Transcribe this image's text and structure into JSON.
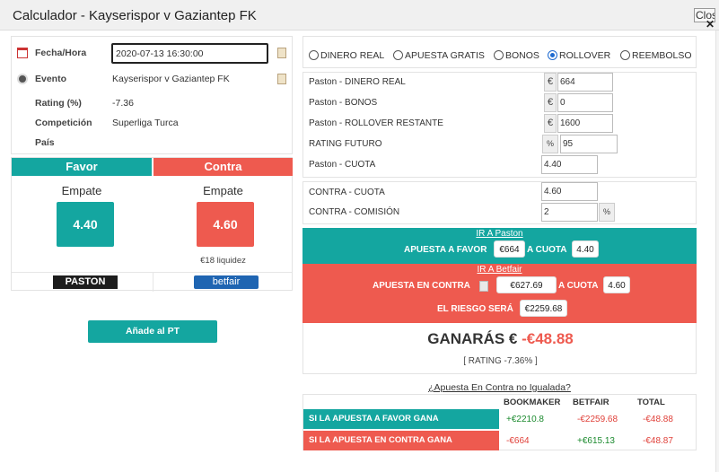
{
  "window": {
    "title": "Calculador - Kayserispor v Gaziantep FK",
    "close_label": "Close"
  },
  "info": {
    "fecha_label": "Fecha/Hora",
    "fecha_value": "2020-07-13 16:30:00",
    "evento_label": "Evento",
    "evento_value": "Kayserispor v Gaziantep FK",
    "rating_label": "Rating (%)",
    "rating_value": "-7.36",
    "competicion_label": "Competición",
    "competicion_value": "Superliga Turca",
    "pais_label": "País",
    "pais_value": ""
  },
  "odds": {
    "favor_label": "Favor",
    "contra_label": "Contra",
    "favor_selection": "Empate",
    "contra_selection": "Empate",
    "favor_odd": "4.40",
    "contra_odd": "4.60",
    "liquidez": "€18 liquidez",
    "paston_logo": "PASTON",
    "betfair_logo": "betfair"
  },
  "add_button": "Añade al PT",
  "radios": [
    {
      "label": "DINERO REAL",
      "selected": false
    },
    {
      "label": "APUESTA GRATIS",
      "selected": false
    },
    {
      "label": "BONOS",
      "selected": false
    },
    {
      "label": "ROLLOVER",
      "selected": true
    },
    {
      "label": "REEMBOLSO",
      "selected": false
    }
  ],
  "fields": {
    "dinero_real_label": "Paston - DINERO REAL",
    "dinero_real_value": "664",
    "bonos_label": "Paston - BONOS",
    "bonos_value": "0",
    "rollover_label": "Paston - ROLLOVER RESTANTE",
    "rollover_value": "1600",
    "rating_futuro_label": "RATING FUTURO",
    "rating_futuro_value": "95",
    "cuota_label": "Paston - CUOTA",
    "cuota_value": "4.40",
    "currency": "€",
    "percent": "%"
  },
  "contra": {
    "cuota_label": "CONTRA - CUOTA",
    "cuota_value": "4.60",
    "comision_label": "CONTRA - COMISIÓN",
    "comision_value": "2",
    "percent": "%"
  },
  "paston_band": {
    "link": "IR A Paston",
    "apuesta_label": "APUESTA A FAVOR",
    "apuesta_value": "€664",
    "cuota_label": "A CUOTA",
    "cuota_value": "4.40"
  },
  "betfair_band": {
    "link": "IR A Betfair",
    "apuesta_label": "APUESTA EN CONTRA",
    "apuesta_value": "€627.69",
    "cuota_label": "A CUOTA",
    "cuota_value": "4.60",
    "riesgo_label": "EL RIESGO SERÁ",
    "riesgo_value": "€2259.68"
  },
  "result": {
    "label": "GANARÁS €",
    "amount": "-€48.88",
    "rating": "[ RATING -7.36% ]"
  },
  "unmatched_link": "¿Apuesta En Contra no Igualada?",
  "table": {
    "headers": [
      "BOOKMAKER",
      "BETFAIR",
      "TOTAL"
    ],
    "rows": [
      {
        "label": "SI LA APUESTA A FAVOR GANA",
        "bookmaker": "+€2210.8",
        "betfair": "-€2259.68",
        "total": "-€48.88"
      },
      {
        "label": "SI LA APUESTA EN CONTRA GANA",
        "bookmaker": "-€664",
        "betfair": "+€615.13",
        "total": "-€48.87"
      }
    ]
  },
  "colors": {
    "favor": "#14a6a0",
    "contra": "#ee5a4f",
    "positive": "#1b8a2e",
    "negative": "#e0413a"
  }
}
